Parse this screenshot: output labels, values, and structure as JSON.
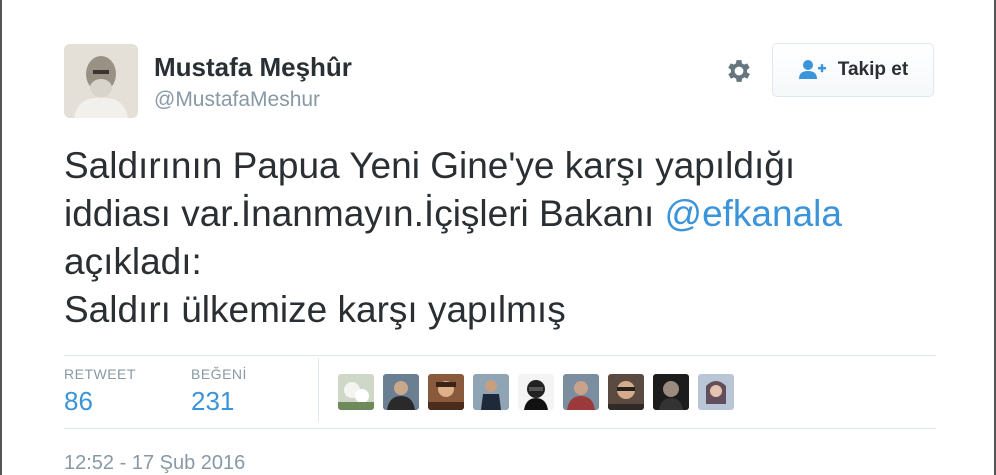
{
  "author": {
    "name": "Mustafa Meşhûr",
    "handle": "@MustafaMeshur"
  },
  "actions": {
    "follow_label": "Takip et",
    "settings_icon": "gear-icon",
    "follow_icon": "add-user-icon"
  },
  "tweet": {
    "line1": "Saldırının Papua Yeni Gine'ye karşı yapıldığı",
    "line2_text": "iddiası var.İnanmayın.İçişleri Bakanı ",
    "mention": "@efkanala",
    "line3": "açıkladı:",
    "line4": "Saldırı ülkemize karşı yapılmış"
  },
  "stats": {
    "retweets_label": "RETWEET",
    "retweets_value": "86",
    "likes_label": "BEĞENİ",
    "likes_value": "231"
  },
  "likers_count_shown": 9,
  "timestamp": "12:52 - 17 Şub 2016",
  "colors": {
    "link": "#3b94d9",
    "muted": "#8899a6",
    "text": "#292f33",
    "border": "#e1e8ed"
  }
}
